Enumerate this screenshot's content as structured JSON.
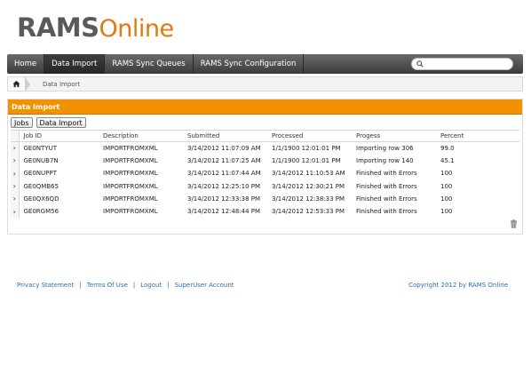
{
  "brand": {
    "name_bold": "RAMS",
    "name_light": "Online"
  },
  "nav": {
    "items": [
      {
        "label": "Home"
      },
      {
        "label": "Data Import"
      },
      {
        "label": "RAMS Sync Queues"
      },
      {
        "label": "RAMS Sync Configuration"
      }
    ],
    "active": "Data Import",
    "search_value": ""
  },
  "breadcrumb": {
    "current": "Data Import"
  },
  "panel": {
    "title": "Data Import",
    "tabs": [
      "Jobs",
      "Data Import"
    ],
    "table": {
      "columns": [
        "Job ID",
        "Description",
        "Submitted",
        "Processed",
        "Progess",
        "Percent"
      ],
      "rows": [
        [
          "GE0NTYUT",
          "IMPORTFROMXML",
          "3/14/2012 11:07:09 AM",
          "1/1/1900 12:01:01 PM",
          "Importing row 306",
          "99.0"
        ],
        [
          "GE0NUB7N",
          "IMPORTFROMXML",
          "3/14/2012 11:07:25 AM",
          "1/1/1900 12:01:01 PM",
          "Importing row 140",
          "45.1"
        ],
        [
          "GE0NUPPT",
          "IMPORTFROMXML",
          "3/14/2012 11:07:44 AM",
          "3/14/2012 11:10:53 AM",
          "Finished with Errors",
          "100"
        ],
        [
          "GE0QMB65",
          "IMPORTFROMXML",
          "3/14/2012 12:25:10 PM",
          "3/14/2012 12:30:21 PM",
          "Finished with Errors",
          "100"
        ],
        [
          "GE0QX6QD",
          "IMPORTFROMXML",
          "3/14/2012 12:33:38 PM",
          "3/14/2012 12:38:33 PM",
          "Finished with Errors",
          "100"
        ],
        [
          "GE0RGM56",
          "IMPORTFROMXML",
          "3/14/2012 12:48:44 PM",
          "3/14/2012 12:53:33 PM",
          "Finished with Errors",
          "100"
        ]
      ]
    }
  },
  "footer": {
    "links": [
      "Privacy Statement",
      "Terms Of Use",
      "Logout",
      "SuperUser Account"
    ],
    "separator": "|",
    "copyright": "Copyright 2012 by RAMS Online"
  },
  "colors": {
    "accent": "#f39200",
    "nav_dark": "#3b3b3b",
    "link": "#2a6fb4",
    "brand_grey": "#5a5a5a"
  }
}
